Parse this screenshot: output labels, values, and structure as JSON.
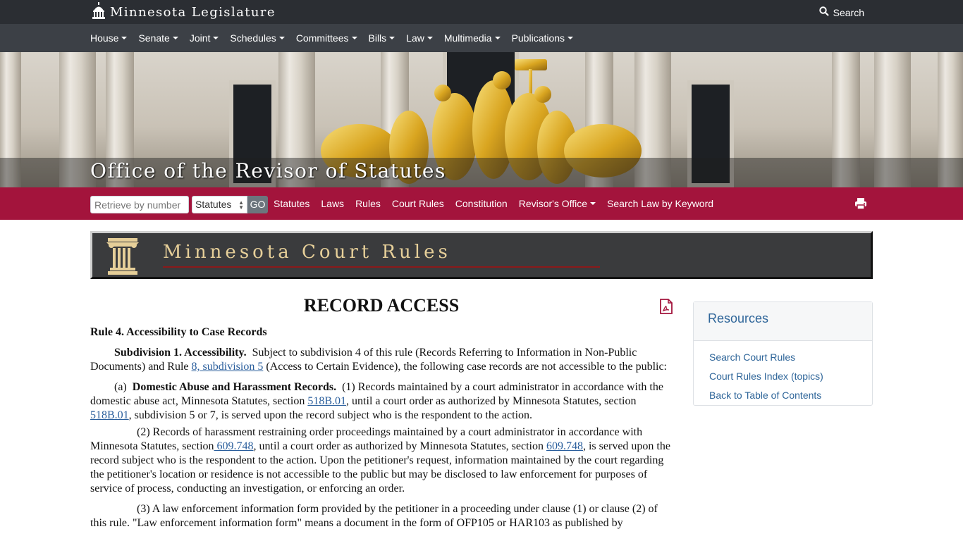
{
  "topbar": {
    "brand": "Minnesota Legislature",
    "search": "Search"
  },
  "mainnav": [
    "House",
    "Senate",
    "Joint",
    "Schedules",
    "Committees",
    "Bills",
    "Law",
    "Multimedia",
    "Publications"
  ],
  "banner": {
    "title": "Office of the Revisor of Statutes"
  },
  "revbar": {
    "retrieve_placeholder": "Retrieve by number",
    "select_value": "Statutes",
    "go": "GO",
    "links": [
      "Statutes",
      "Laws",
      "Rules",
      "Court Rules",
      "Constitution",
      "Revisor's Office",
      "Search Law by Keyword"
    ]
  },
  "court_rules_header": "Minnesota Court Rules",
  "doc": {
    "title": "RECORD ACCESS",
    "rule_heading": "Rule 4.  Accessibility to Case Records",
    "subdiv_label": "Subdivision 1.  Accessibility.",
    "subdiv_text_1": "Subject to subdivision 4 of this rule (Records Referring to Information in Non-Public Documents) and Rule ",
    "subdiv_link": "8, subdivision 5",
    "subdiv_text_2": " (Access to Certain Evidence), the following case records are not accessible to the public:",
    "a_label": "(a)",
    "a_heading": "Domestic Abuse and Harassment Records.",
    "a1_text_1": "(1) Records maintained by a court administrator in accordance with the domestic abuse act, Minnesota Statutes, section ",
    "a1_link_1": "518B.01",
    "a1_text_2": ", until a court order as authorized by Minnesota Statutes, section ",
    "a1_link_2": "518B.01",
    "a1_text_3": ", subdivision 5 or 7, is served upon the record subject who is the respondent to the action.",
    "a2_text_1": "(2) Records of harassment restraining order proceedings maintained by a court administrator in accordance with Minnesota Statutes, section",
    "a2_link_1": " 609.748",
    "a2_text_2": ", until a court order as authorized by Minnesota Statutes, section ",
    "a2_link_2": "609.748",
    "a2_text_3": ", is served upon the record subject who is the respondent to the action. Upon the petitioner's request, information maintained by the court regarding the petitioner's location or residence is not accessible to the public but may be disclosed to law enforcement for purposes of service of process, conducting an investigation, or enforcing an order.",
    "a3_text": "(3) A law enforcement information form provided by the petitioner in a proceeding under clause (1) or clause (2) of this rule. \"Law enforcement information form\" means a document in the form of OFP105 or HAR103 as published by"
  },
  "resources": {
    "title": "Resources",
    "links": [
      "Search Court Rules",
      "Court Rules Index (topics)",
      "Back to Table of Contents"
    ]
  }
}
